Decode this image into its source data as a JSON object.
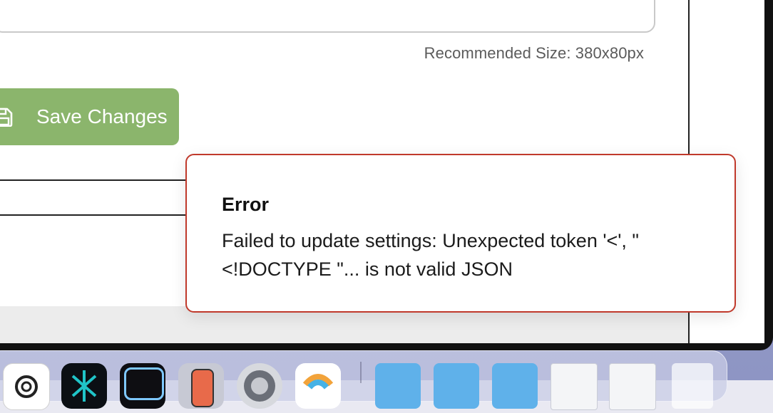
{
  "form": {
    "hint": "Recommended Size: 380x80px",
    "save_label": "Save Changes"
  },
  "toast": {
    "title": "Error",
    "message": "Failed to update settings: Unexpected token '<', \"<!DOCTYPE \"... is not valid JSON"
  },
  "dock": {
    "apps": [
      {
        "icon": "chatgpt-icon"
      },
      {
        "icon": "perplexity-icon"
      },
      {
        "icon": "screen-app-icon"
      },
      {
        "icon": "iphone-mirroring-icon"
      },
      {
        "icon": "system-settings-icon"
      },
      {
        "icon": "app-icon"
      }
    ],
    "stacks": [
      {
        "icon": "folder-icon"
      },
      {
        "icon": "folder-icon"
      },
      {
        "icon": "folder-icon"
      },
      {
        "icon": "screenshot-thumbnail-icon"
      },
      {
        "icon": "screenshot-thumbnail-icon"
      },
      {
        "icon": "trash-icon"
      }
    ]
  },
  "colors": {
    "accent_green": "#8bb56c",
    "error_border": "#c0392b"
  }
}
